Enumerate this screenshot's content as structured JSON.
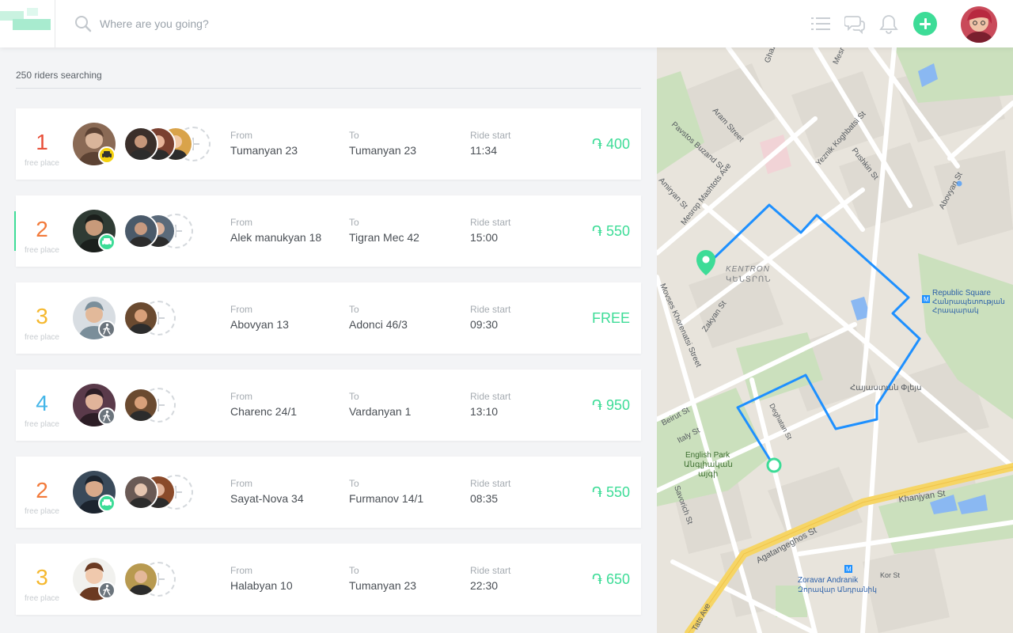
{
  "header": {
    "search_placeholder": "Where are you going?",
    "icons": [
      "list-icon",
      "chat-icon",
      "bell-icon",
      "add-icon"
    ]
  },
  "riders_count": "250 riders searching",
  "labels": {
    "from": "From",
    "to": "To",
    "ride_start": "Ride start",
    "free_place": "free place"
  },
  "rides": [
    {
      "seats": "1",
      "seat_color": "#e8503a",
      "badge": "taxi",
      "from": "Tumanyan 23",
      "to": "Tumanyan 23",
      "time": "11:34",
      "price": "֏ 400",
      "passengers": 3,
      "active": false
    },
    {
      "seats": "2",
      "seat_color": "#f27a3a",
      "badge": "car",
      "from": "Alek manukyan 18",
      "to": "Tigran Mec 42",
      "time": "15:00",
      "price": "֏ 550",
      "passengers": 2,
      "active": true
    },
    {
      "seats": "3",
      "seat_color": "#f5b82e",
      "badge": "walk",
      "from": "Abovyan 13",
      "to": "Adonci 46/3",
      "time": "09:30",
      "price": "FREE",
      "passengers": 1,
      "active": false
    },
    {
      "seats": "4",
      "seat_color": "#45b6e8",
      "badge": "walk",
      "from": "Charenc 24/1",
      "to": "Vardanyan 1",
      "time": "13:10",
      "price": "֏ 950",
      "passengers": 1,
      "active": false
    },
    {
      "seats": "2",
      "seat_color": "#f27a3a",
      "badge": "car",
      "from": "Sayat-Nova 34",
      "to": "Furmanov 14/1",
      "time": "08:35",
      "price": "֏ 550",
      "passengers": 2,
      "active": false
    },
    {
      "seats": "3",
      "seat_color": "#f5b82e",
      "badge": "walk",
      "from": "Halabyan 10",
      "to": "Tumanyan 23",
      "time": "22:30",
      "price": "֏ 650",
      "passengers": 1,
      "active": false
    }
  ],
  "map": {
    "labels": {
      "ghazar": "Ghaza",
      "mesrop": "Mesr",
      "aram": "Aram Street",
      "pavstos": "Pavstos Buzand St",
      "yeznik": "Yeznik Koghbatsi St",
      "pushkin": "Pushkin St",
      "abovyan": "Abovyan St",
      "mashtots": "Mesrop Mashtots Ave",
      "amiryan": "Amiryan St",
      "kentron": "KENTRON",
      "kentron_am": "ԿԵՆՏՐՈՆ",
      "republic": "Republic Square",
      "republic_am1": "Հանրապետության",
      "republic_am2": "Հրապարակ",
      "khorenatsi": "Movses Khorenatsi Street",
      "zakyan": "Zakyan St",
      "hayastan": "Հայաստան Փլեյս",
      "beirut": "Beirut St",
      "italy": "Italy St",
      "deghatan": "Deghatan St",
      "english_park": "English Park",
      "english_park_am1": "Անգլիական",
      "english_park_am2": "այգի",
      "khanjyan": "Khanjyan St",
      "agatangeghos": "Agatangeghos St",
      "savorich": "Savorich St",
      "zoravar": "Zoravar Andranik",
      "zoravar_am": "Զորավար Անդրանիկ",
      "kor": "Kor St",
      "tats": "Tats Ave"
    },
    "route_color": "#1e90ff",
    "accent": "#3ddc97"
  }
}
